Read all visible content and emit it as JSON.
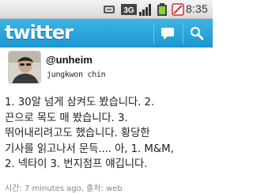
{
  "status_bar": {
    "time": "8:35",
    "icons": [
      "usb-debug-icon",
      "3g-icon",
      "signal-strength-icon",
      "battery-icon",
      "alarm-icon"
    ]
  },
  "header": {
    "logo_text": "twitter",
    "brand_color": "#26a3dd",
    "actions": [
      "compose-icon",
      "search-icon"
    ]
  },
  "tweet": {
    "username": "@unheim",
    "real_name": "jungkwon chin",
    "text_lines": [
      "1. 30알 넘게 삼켜도 봤습니다. 2.",
      "끈으로 목도 매 봤습니다. 3.",
      "뛰어내리려고도 했습니다. 황당한",
      "기사를 읽고나서 문득.... 아, 1. M&M,",
      "2. 넥타이 3. 번지점프 얘깁니다."
    ],
    "meta": "시간: 7 minutes ago, 출처: web"
  }
}
